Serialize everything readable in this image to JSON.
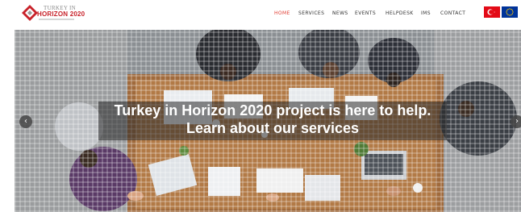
{
  "logo": {
    "line1": "TURKEY IN",
    "line2": "HORIZON 2020"
  },
  "nav": {
    "items": [
      {
        "label": "HOME",
        "active": true
      },
      {
        "label": "SERVICES",
        "active": false
      },
      {
        "label": "NEWS",
        "active": false
      },
      {
        "label": "EVENTS",
        "active": false
      },
      {
        "label": "HELPDESK",
        "active": false
      },
      {
        "label": "IMS",
        "active": false
      },
      {
        "label": "CONTACT",
        "active": false
      }
    ]
  },
  "flags": [
    "turkey-flag",
    "eu-flag"
  ],
  "hero": {
    "line1": "Turkey in Horizon 2020 project is here to help.",
    "line2": "Learn about our services",
    "prev_icon": "chevron-left-icon",
    "next_icon": "chevron-right-icon"
  },
  "colors": {
    "accent": "#e03a2f",
    "nav_text": "#333333",
    "caption_bg": "rgba(40,40,40,0.55)"
  }
}
